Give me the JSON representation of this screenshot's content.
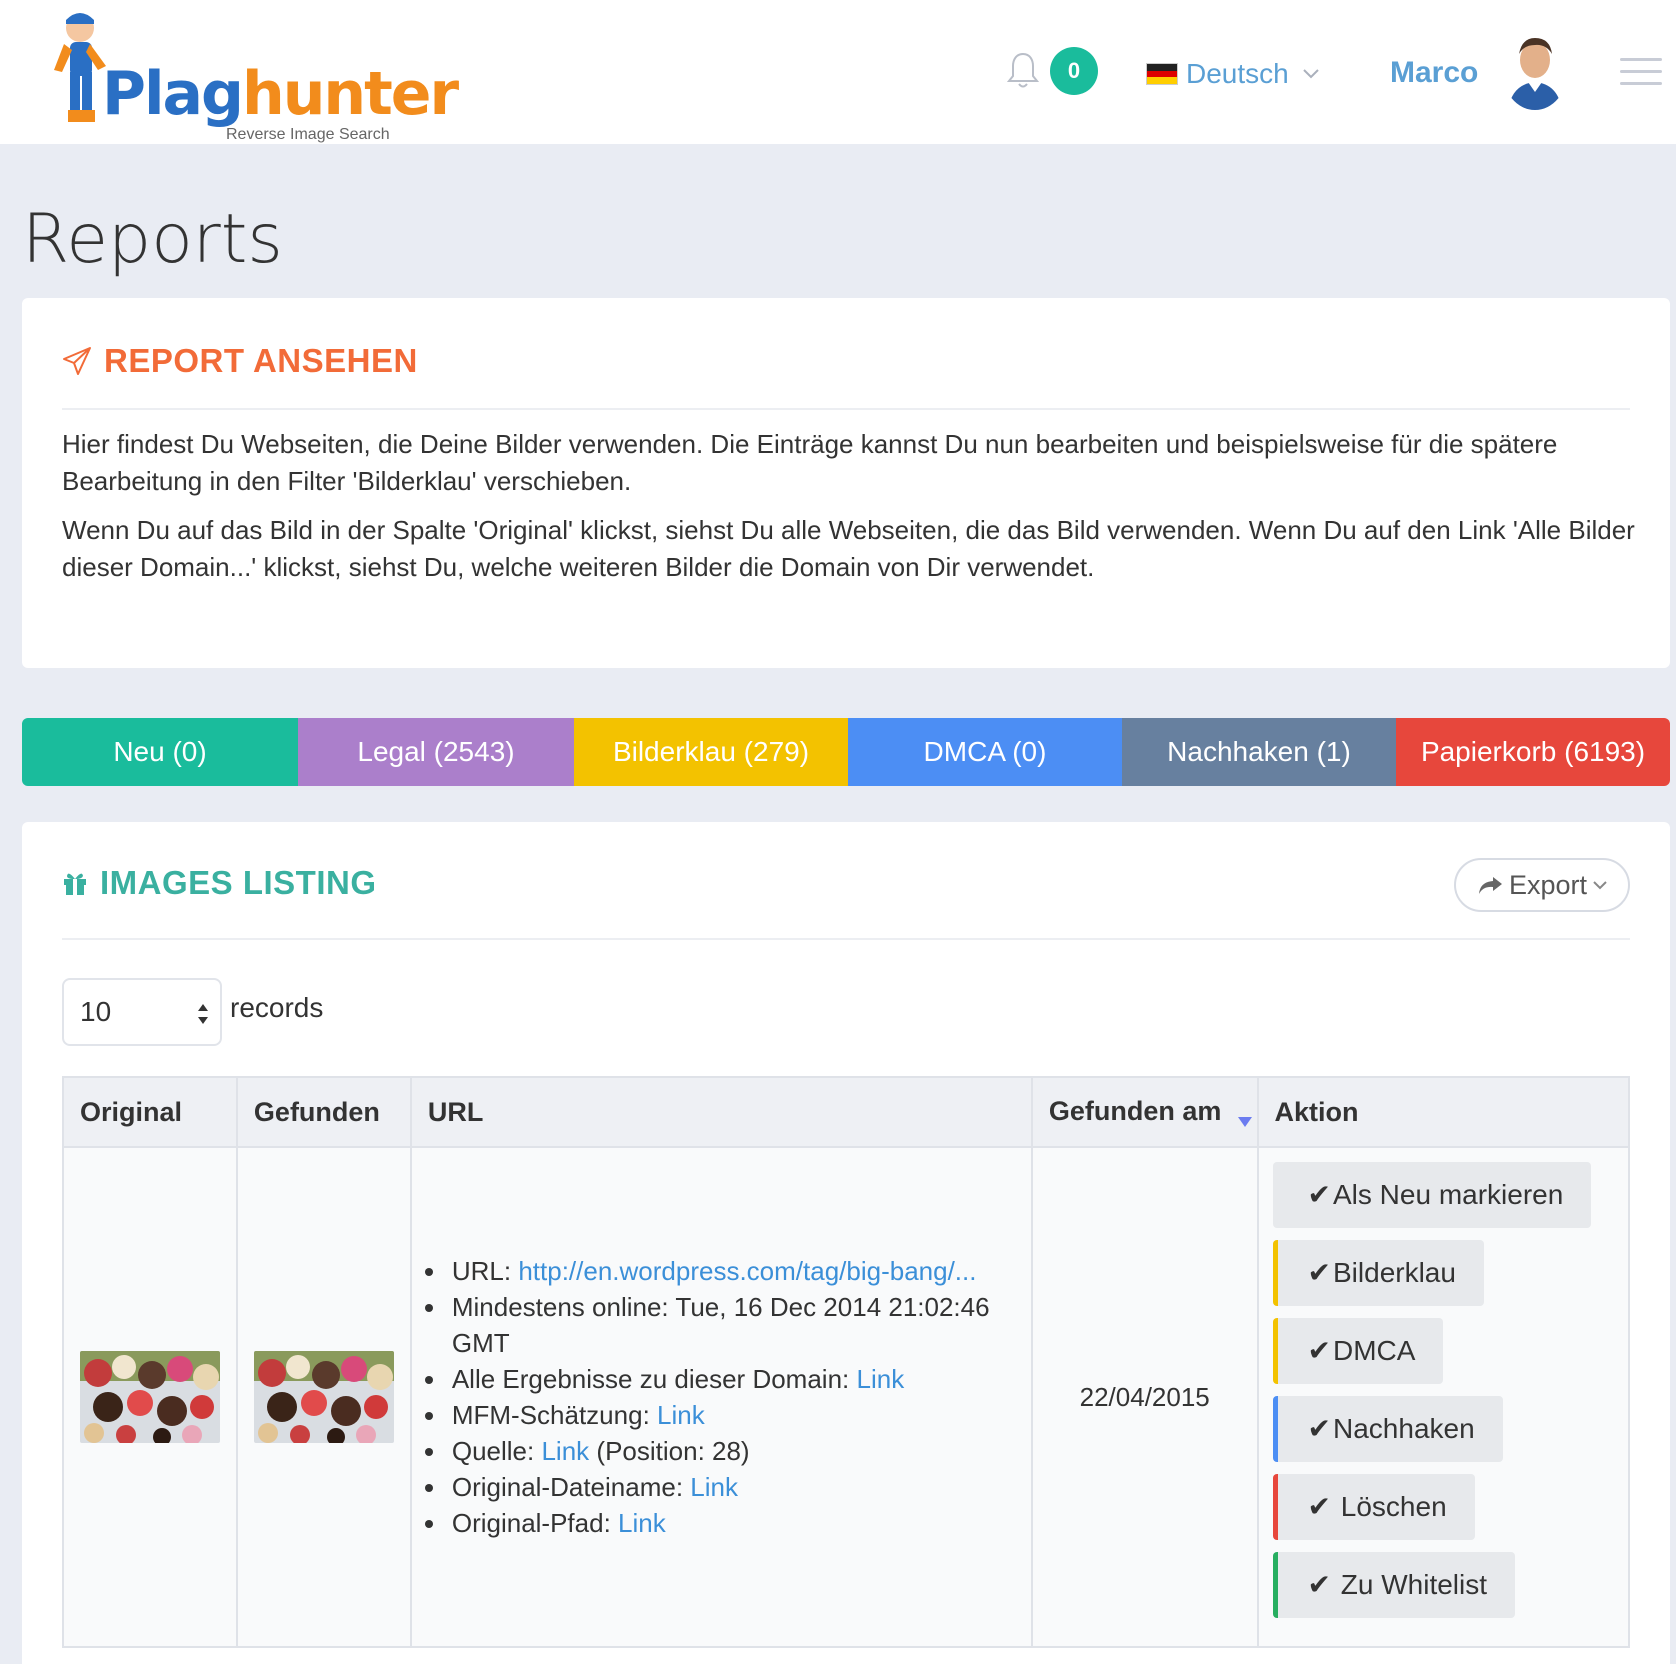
{
  "header": {
    "logo_text_1": "Plag",
    "logo_text_2": "hunter",
    "logo_tagline": "Reverse Image Search",
    "notifications_count": "0",
    "language": "Deutsch",
    "user_name": "Marco"
  },
  "page": {
    "title": "Reports"
  },
  "report_panel": {
    "heading": "REPORT ANSEHEN",
    "paragraph_1": "Hier findest Du Webseiten, die Deine Bilder verwenden. Die Einträge kannst Du nun bearbeiten und beispielsweise für die spätere Bearbeitung in den Filter 'Bilderklau' verschieben.",
    "paragraph_2": "Wenn Du auf das Bild in der Spalte 'Original' klickst, siehst Du alle Webseiten, die das Bild verwenden. Wenn Du auf den Link 'Alle Bilder dieser Domain...' klickst, siehst Du, welche weiteren Bilder die Domain von Dir verwendet."
  },
  "filter_tabs": [
    {
      "label": "Neu (0)",
      "color": "#1abc9c"
    },
    {
      "label": "Legal (2543)",
      "color": "#ab7fcb"
    },
    {
      "label": "Bilderklau (279)",
      "color": "#f3c200"
    },
    {
      "label": "DMCA (0)",
      "color": "#4c8ef4"
    },
    {
      "label": "Nachhaken (1)",
      "color": "#67809f"
    },
    {
      "label": "Papierkorb (6193)",
      "color": "#e7473c"
    }
  ],
  "listing": {
    "heading": "IMAGES LISTING",
    "export_label": "Export",
    "records_value": "10",
    "records_label": "records",
    "columns": [
      "Original",
      "Gefunden",
      "URL",
      "Gefunden am",
      "Aktion"
    ],
    "rows": [
      {
        "url_label": "URL:",
        "url_value": "http://en.wordpress.com/tag/big-bang/...",
        "online_label": "Mindestens online:",
        "online_value": "Tue, 16 Dec 2014 21:02:46 GMT",
        "domain_label": "Alle Ergebnisse zu dieser Domain:",
        "mfm_label": "MFM-Schätzung:",
        "quelle_label": "Quelle:",
        "quelle_suffix": "(Position: 28)",
        "dateiname_label": "Original-Dateiname:",
        "pfad_label": "Original-Pfad:",
        "link_text": "Link",
        "date": "22/04/2015"
      }
    ],
    "actions": [
      {
        "label": "Als Neu markieren",
        "accent": ""
      },
      {
        "label": "Bilderklau",
        "accent": "#f3c200"
      },
      {
        "label": "DMCA",
        "accent": "#f3c200"
      },
      {
        "label": "Nachhaken",
        "accent": "#4c8ef4"
      },
      {
        "label": " Löschen",
        "accent": "#e7473c"
      },
      {
        "label": " Zu Whitelist",
        "accent": "#27ae60"
      }
    ]
  },
  "colors": {
    "accent_orange": "#f26b38",
    "accent_teal": "#3ab0a0",
    "link_blue": "#3b8fd8"
  },
  "icons": {
    "bell": "bell-icon",
    "paper_plane": "paper-plane-icon",
    "gift": "gift-icon",
    "share": "share-icon",
    "check": "check-icon",
    "menu": "hamburger-icon"
  }
}
